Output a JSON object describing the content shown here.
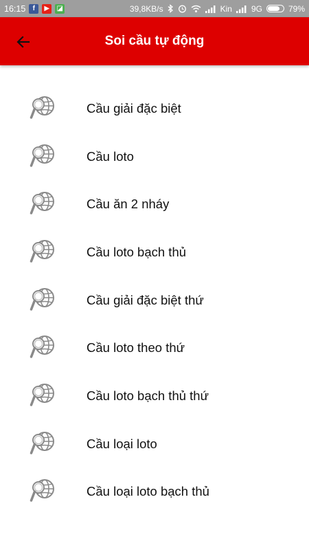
{
  "status_bar": {
    "time": "16:15",
    "network_speed": "39,8KB/s",
    "carrier": "Kin",
    "network_type": "9G",
    "battery_percent": "79%",
    "battery_level": 0.79,
    "app_icons": [
      "facebook-icon",
      "youtube-icon",
      "green-app-icon"
    ]
  },
  "header": {
    "title": "Soi cầu tự động",
    "background_color": "#dd0000"
  },
  "menu": {
    "items": [
      {
        "label": "Cầu giải đặc biệt"
      },
      {
        "label": "Cầu loto"
      },
      {
        "label": "Cầu ăn 2 nháy"
      },
      {
        "label": "Cầu loto bạch thủ"
      },
      {
        "label": "Cầu giải đặc biệt thứ"
      },
      {
        "label": "Cầu loto theo thứ"
      },
      {
        "label": "Cầu loto bạch thủ thứ"
      },
      {
        "label": "Cầu loại loto"
      },
      {
        "label": "Cầu loại loto bạch thủ"
      }
    ],
    "item_icon": "globe-search-icon"
  }
}
